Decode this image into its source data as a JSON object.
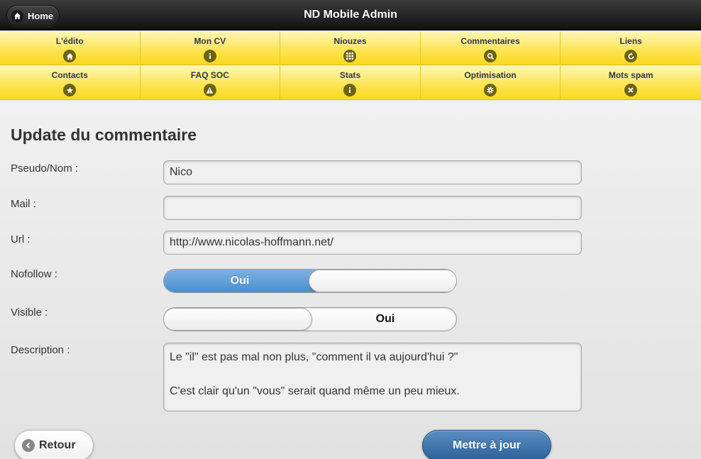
{
  "header": {
    "home_label": "Home",
    "title": "ND Mobile Admin"
  },
  "nav": [
    {
      "label": "L'édito",
      "icon": "home-icon"
    },
    {
      "label": "Mon CV",
      "icon": "info-icon"
    },
    {
      "label": "Niouzes",
      "icon": "grid-icon"
    },
    {
      "label": "Commentaires",
      "icon": "search-icon"
    },
    {
      "label": "Liens",
      "icon": "refresh-icon"
    },
    {
      "label": "Contacts",
      "icon": "star-icon"
    },
    {
      "label": "FAQ SOC",
      "icon": "alert-icon"
    },
    {
      "label": "Stats",
      "icon": "info-icon"
    },
    {
      "label": "Optimisation",
      "icon": "gear-icon"
    },
    {
      "label": "Mots spam",
      "icon": "delete-icon"
    }
  ],
  "form": {
    "title": "Update du commentaire",
    "pseudo_label": "Pseudo/Nom :",
    "pseudo_value": "Nico",
    "mail_label": "Mail :",
    "mail_value": "",
    "url_label": "Url :",
    "url_value": "http://www.nicolas-hoffmann.net/",
    "nofollow_label": "Nofollow :",
    "nofollow_text": "Oui",
    "visible_label": "Visible :",
    "visible_text": "Oui",
    "description_label": "Description :",
    "description_value": "Le \"il\" est pas mal non plus, \"comment il va aujourd'hui ?\"\n\nC'est clair qu'un \"vous\" serait quand même un peu mieux."
  },
  "buttons": {
    "back_label": "Retour",
    "update_label": "Mettre à jour"
  },
  "colors": {
    "nav_yellow": "#fce34e",
    "accent_blue": "#4a8fcf",
    "header_dark": "#222222"
  }
}
